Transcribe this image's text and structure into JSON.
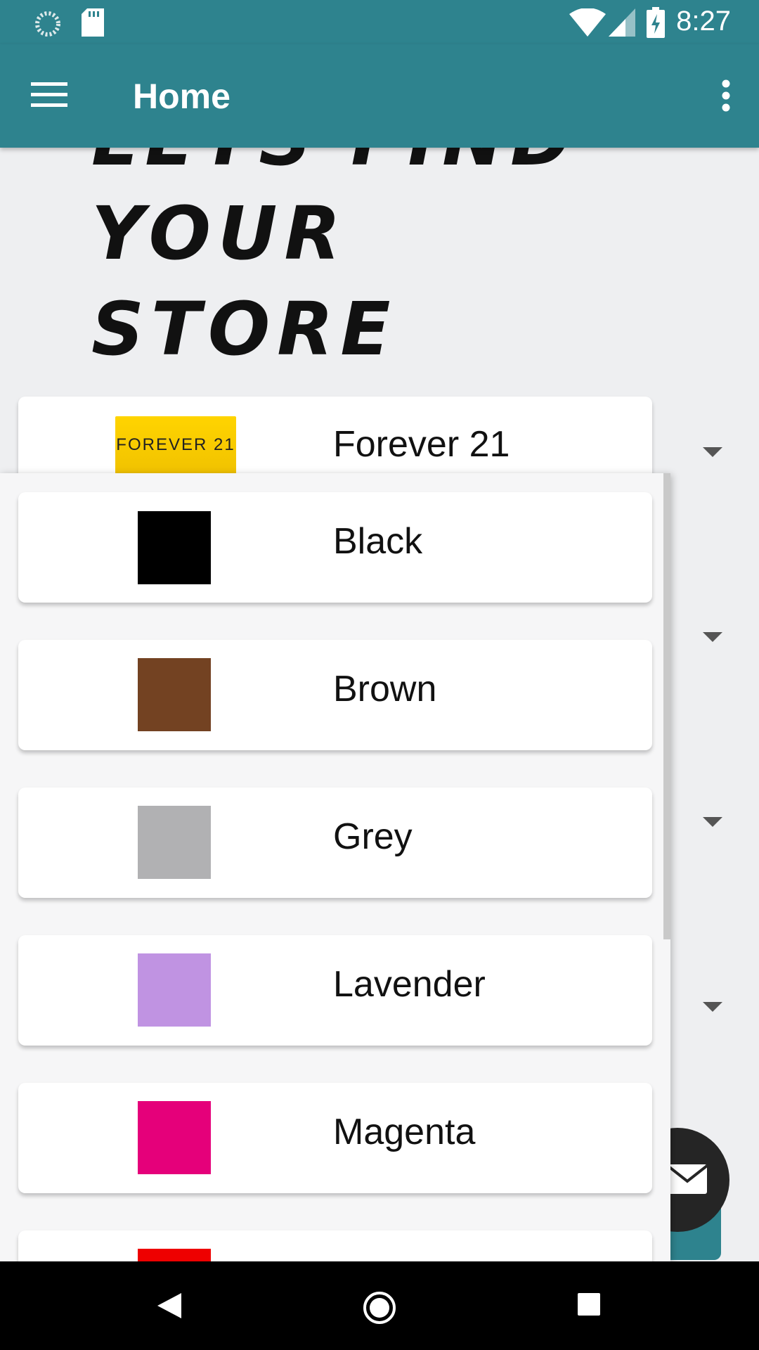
{
  "status_bar": {
    "time": "8:27",
    "icons": [
      "sync-icon",
      "sd-card-icon",
      "wifi-icon",
      "signal-icon",
      "battery-charging-icon"
    ]
  },
  "app_bar": {
    "title": "Home",
    "menu_icon": "hamburger-menu-icon",
    "more_icon": "more-vert-icon"
  },
  "hero": {
    "line1": "Lets Find",
    "line2": "Your Store"
  },
  "store_spinner": {
    "selected_label": "Forever 21",
    "logo_text": "FOREVER 21"
  },
  "color_options": [
    {
      "label": "Black",
      "color": "#000000"
    },
    {
      "label": "Brown",
      "color": "#734222"
    },
    {
      "label": "Grey",
      "color": "#b1b1b3"
    },
    {
      "label": "Lavender",
      "color": "#c093e2"
    },
    {
      "label": "Magenta",
      "color": "#e5007a"
    },
    {
      "label": "",
      "color": "#ee0000"
    }
  ],
  "colors": {
    "primary": "#2e838e",
    "background": "#eeeff1",
    "fab": "#252525"
  }
}
